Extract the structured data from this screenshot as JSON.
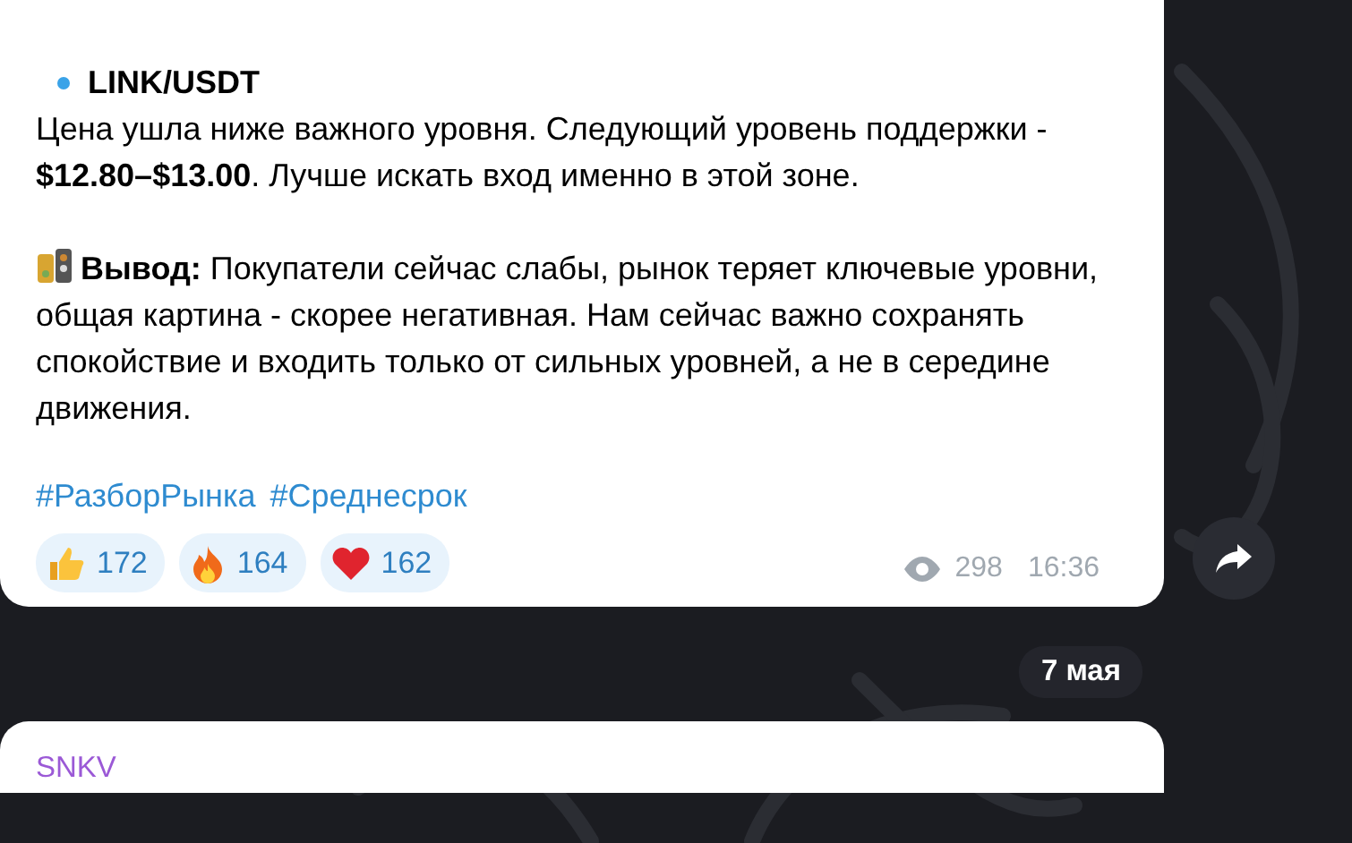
{
  "post": {
    "bullet_title": "LINK/USDT",
    "paragraph": "Цена ушла ниже важного уровня. Следующий уровень поддержки - **$12.80–$13.00**. Лучше искать вход именно в этой зоне.",
    "conclusion": "**Вывод:** Покупатели сейчас слабы, рынок теряет ключевые уровни, общая картина - скорее негативная. Нам сейчас важно сохранять спокойствие и входить только от сильных уровней, а не в середине движения.",
    "hashtags": [
      "#РазборРынка",
      "#Среднесрок"
    ],
    "reactions": [
      {
        "kind": "thumbs-up",
        "count": "172"
      },
      {
        "kind": "fire",
        "count": "164"
      },
      {
        "kind": "heart",
        "count": "162"
      }
    ],
    "views": "298",
    "time": "16:36"
  },
  "date_separator": "7 мая",
  "next_post": {
    "author": "SNKV"
  }
}
